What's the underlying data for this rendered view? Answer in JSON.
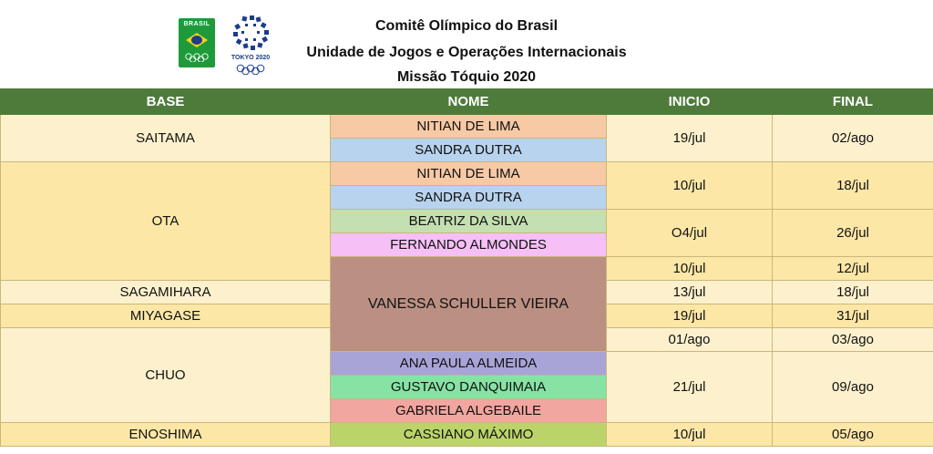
{
  "header": {
    "line1": "Comitê Olímpico do Brasil",
    "line2": "Unidade de Jogos e Operações Internacionais",
    "line3": "Missão Tóquio 2020",
    "logo_brasil_text": "BRASIL",
    "logo_tokyo_text": "TOKYO 2020"
  },
  "columns": [
    "BASE",
    "NOME",
    "INICIO",
    "FINAL"
  ],
  "rows": {
    "saitama": {
      "base": "SAITAMA",
      "nome1": "NITIAN DE LIMA",
      "nome2": "SANDRA DUTRA",
      "inicio": "19/jul",
      "final": "02/ago"
    },
    "ota": {
      "base": "OTA",
      "nome1": "NITIAN DE LIMA",
      "nome2": "SANDRA DUTRA",
      "inicio1": "10/jul",
      "final1": "18/jul",
      "nome3": "BEATRIZ DA SILVA",
      "nome4": "FERNANDO ALMONDES",
      "inicio2": "O4/jul",
      "final2": "26/jul",
      "inicio3": "10/jul",
      "final3": "12/jul"
    },
    "vanessa": "VANESSA SCHULLER VIEIRA",
    "sagamihara": {
      "base": "SAGAMIHARA",
      "inicio": "13/jul",
      "final": "18/jul"
    },
    "miyagase": {
      "base": "MIYAGASE",
      "inicio": "19/jul",
      "final": "31/jul"
    },
    "chuo": {
      "base": "CHUO",
      "inicio1": "01/ago",
      "final1": "03/ago",
      "nome1": "ANA PAULA ALMEIDA",
      "nome2": "GUSTAVO  DANQUIMAIA",
      "nome3": "GABRIELA ALGEBAILE",
      "inicio2": "21/jul",
      "final2": "09/ago"
    },
    "enoshima": {
      "base": "ENOSHIMA",
      "nome": "CASSIANO MÁXIMO",
      "inicio": "10/jul",
      "final": "05/ago"
    }
  },
  "colors": {
    "header_green": "#4e7b3a",
    "base_light": "#fdf1cd",
    "base_dark": "#fde7a7"
  }
}
